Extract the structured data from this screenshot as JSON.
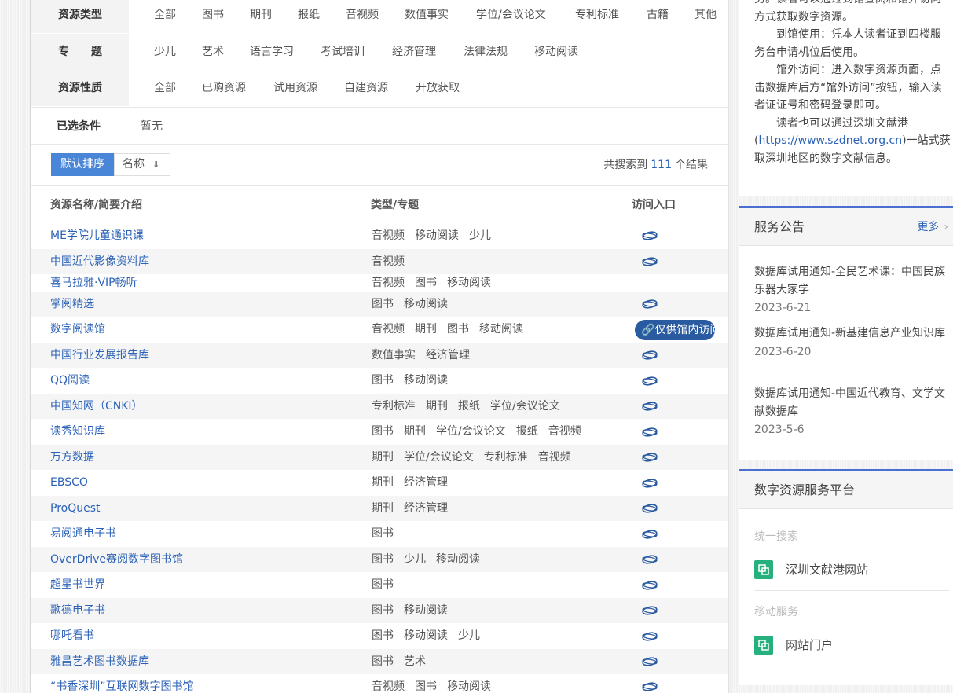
{
  "filters": {
    "resource_type": {
      "label": "资源类型",
      "options": [
        "全部",
        "图书",
        "期刊",
        "报纸",
        "音视频",
        "数值事实",
        "学位/会议论文",
        "专利标准",
        "古籍",
        "其他"
      ]
    },
    "topic": {
      "label": "专　　题",
      "options": [
        "少儿",
        "艺术",
        "语言学习",
        "考试培训",
        "经济管理",
        "法律法规",
        "移动阅读"
      ]
    },
    "nature": {
      "label": "资源性质",
      "options": [
        "全部",
        "已购资源",
        "试用资源",
        "自建资源",
        "开放获取"
      ]
    },
    "selected": {
      "label": "已选条件",
      "value": "暂无"
    }
  },
  "sort": {
    "default_label": "默认排序",
    "name_label": "名称",
    "arrow": "⬇"
  },
  "results": {
    "prefix": "共搜索到",
    "count": "111",
    "suffix": "个结果"
  },
  "table": {
    "headers": {
      "name": "资源名称/简要介绍",
      "type": "类型/专题",
      "access": "访问入口"
    },
    "rows": [
      {
        "name": "ME学院儿童通识课",
        "types": [
          "音视频",
          "移动阅读",
          "少儿"
        ],
        "access": "link"
      },
      {
        "name": "中国近代影像资料库",
        "types": [
          "音视频"
        ],
        "access": "link"
      },
      {
        "name": "喜马拉雅·VIP畅听",
        "types": [
          "音视频",
          "图书",
          "移动阅读"
        ],
        "access": "none"
      },
      {
        "name": "掌阅精选",
        "types": [
          "图书",
          "移动阅读"
        ],
        "access": "link"
      },
      {
        "name": "数字阅读馆",
        "types": [
          "音视频",
          "期刊",
          "图书",
          "移动阅读"
        ],
        "access": "badge"
      },
      {
        "name": "中国行业发展报告库",
        "types": [
          "数值事实",
          "经济管理"
        ],
        "access": "link"
      },
      {
        "name": "QQ阅读",
        "types": [
          "图书",
          "移动阅读"
        ],
        "access": "link"
      },
      {
        "name": "中国知网（CNKI）",
        "types": [
          "专利标准",
          "期刊",
          "报纸",
          "学位/会议论文"
        ],
        "access": "link"
      },
      {
        "name": "读秀知识库",
        "types": [
          "图书",
          "期刊",
          "学位/会议论文",
          "报纸",
          "音视频"
        ],
        "access": "link"
      },
      {
        "name": "万方数据",
        "types": [
          "期刊",
          "学位/会议论文",
          "专利标准",
          "音视频"
        ],
        "access": "link"
      },
      {
        "name": "EBSCO",
        "types": [
          "期刊",
          "经济管理"
        ],
        "access": "link"
      },
      {
        "name": "ProQuest",
        "types": [
          "期刊",
          "经济管理"
        ],
        "access": "link"
      },
      {
        "name": "易阅通电子书",
        "types": [
          "图书"
        ],
        "access": "link"
      },
      {
        "name": "OverDrive赛阅数字图书馆",
        "types": [
          "图书",
          "少儿",
          "移动阅读"
        ],
        "access": "link"
      },
      {
        "name": "超星书世界",
        "types": [
          "图书"
        ],
        "access": "link"
      },
      {
        "name": "歌德电子书",
        "types": [
          "图书",
          "移动阅读"
        ],
        "access": "link"
      },
      {
        "name": "哪吒看书",
        "types": [
          "图书",
          "移动阅读",
          "少儿"
        ],
        "access": "link"
      },
      {
        "name": "雅昌艺术图书数据库",
        "types": [
          "图书",
          "艺术"
        ],
        "access": "link"
      },
      {
        "name": "“书香深圳”互联网数字图书馆",
        "types": [
          "音视频",
          "图书",
          "移动阅读"
        ],
        "access": "link"
      }
    ],
    "badge_text": "🔗仅供馆内访问"
  },
  "sidebar": {
    "info": {
      "p1": "务。读者可以通过到馆查阅和馆外访问方式获取数字资源。",
      "p2": "到馆使用：凭本人读者证到四楼服务台申请机位后使用。",
      "p3": "馆外访问：进入数字资源页面，点击数据库后方“馆外访问”按钮，输入读者证证号和密码登录即可。",
      "p4_a": "读者也可以通过深圳文献港(",
      "p4_link": "https://www.szdnet.org.cn",
      "p4_b": ")一站式获取深圳地区的数字文献信息。"
    },
    "notices": {
      "title": "服务公告",
      "more": "更多",
      "items": [
        {
          "title": "数据库试用通知-全民艺术课：中国民族乐器大家学",
          "date": "2023-6-21"
        },
        {
          "title": "数据库试用通知-新基建信息产业知识库",
          "date": "2023-6-20"
        },
        {
          "title": "数据库试用通知-中国近代教育、文学文献数据库",
          "date": "2023-5-6"
        }
      ]
    },
    "platform": {
      "title": "数字资源服务平台",
      "cat1": "统一搜索",
      "item1": "深圳文献港网站",
      "cat2": "移动服务",
      "item2": "网站门户"
    }
  },
  "colors": {
    "accent": "#4a86d8",
    "link": "#2b62b8",
    "badge": "#2a5aa0",
    "platform_icon": "#25b07e",
    "panel_border": "#4a6fd0"
  }
}
